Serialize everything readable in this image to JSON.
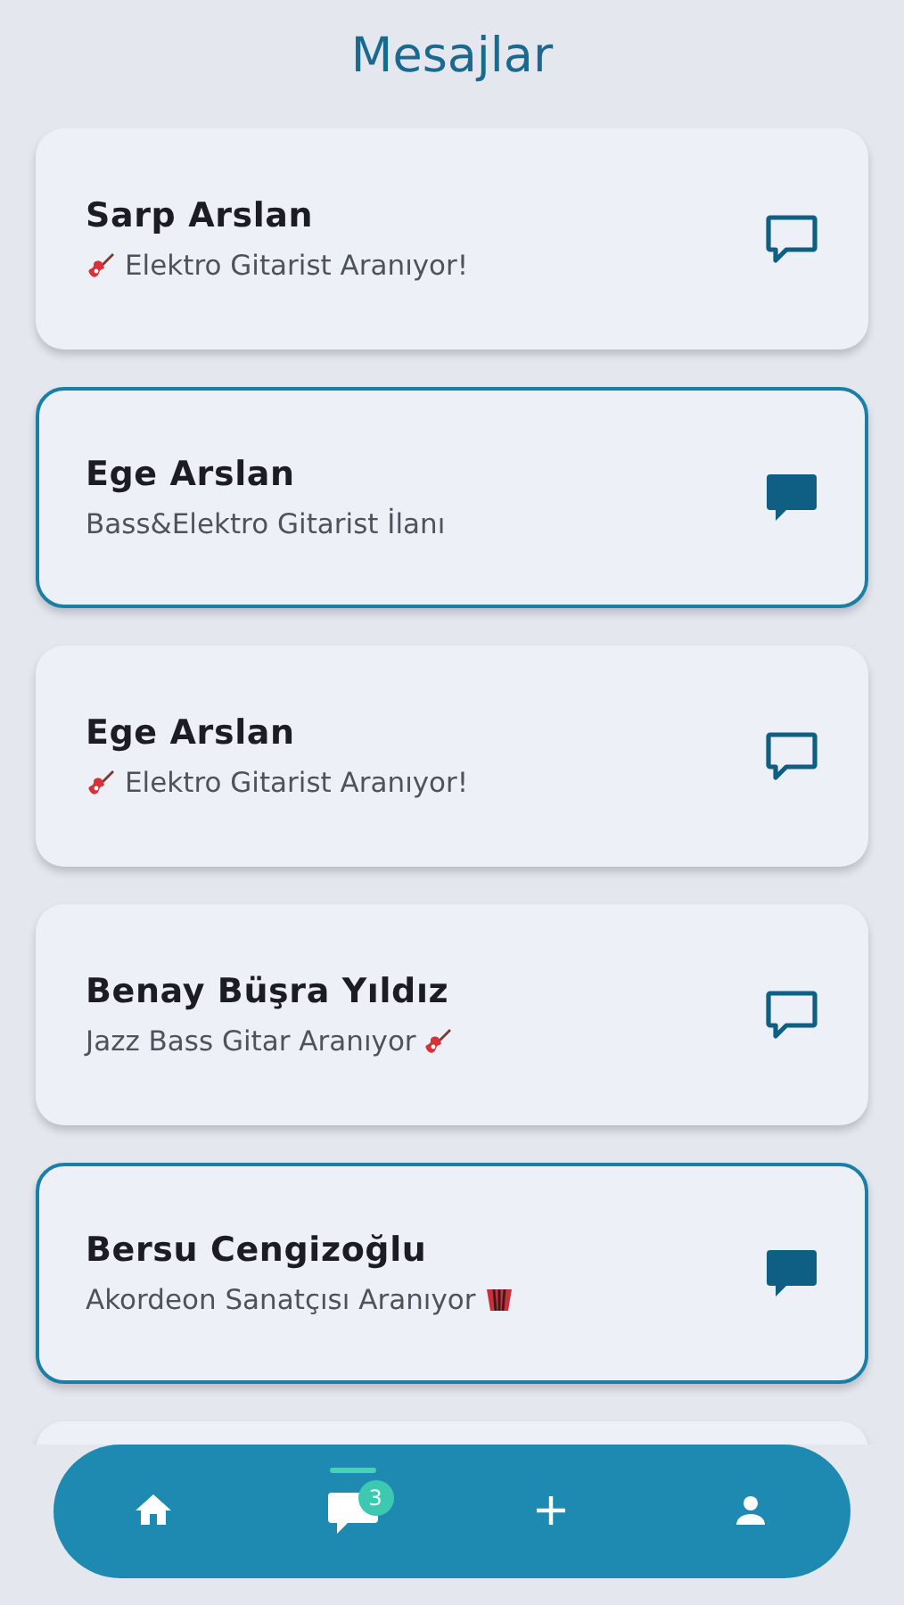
{
  "title": "Mesajlar",
  "conversations": [
    {
      "kind": "guitar_before",
      "name": "Sarp Arslan",
      "subtitle": "Elektro Gitarist Aranıyor!",
      "unread": false
    },
    {
      "kind": "plain",
      "name": "Ege Arslan",
      "subtitle": "Bass&Elektro Gitarist İlanı",
      "unread": true
    },
    {
      "kind": "guitar_before",
      "name": "Ege Arslan",
      "subtitle": "Elektro Gitarist Aranıyor!",
      "unread": false
    },
    {
      "kind": "guitar_after",
      "name": "Benay Büşra Yıldız",
      "subtitle": "Jazz Bass Gitar Aranıyor",
      "unread": false
    },
    {
      "kind": "accordion_after",
      "name": "Bersu Cengizoğlu",
      "subtitle": "Akordeon Sanatçısı Aranıyor",
      "unread": true
    },
    {
      "unread": false
    }
  ],
  "nav": [
    {
      "kind": "home",
      "selected": false
    },
    {
      "kind": "messages",
      "selected": true,
      "badge": "3"
    },
    {
      "kind": "add",
      "selected": false
    },
    {
      "kind": "profile",
      "selected": false
    }
  ]
}
